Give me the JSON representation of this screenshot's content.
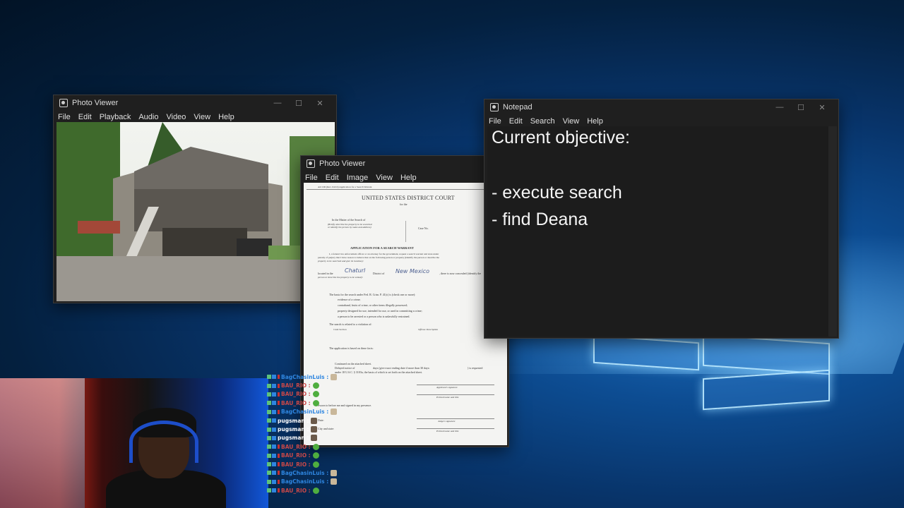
{
  "desktop": {
    "accent": "#0d4d93"
  },
  "photo_viewer_1": {
    "title": "Photo Viewer",
    "menu": [
      "File",
      "Edit",
      "Playback",
      "Audio",
      "Video",
      "View",
      "Help"
    ],
    "image_alt": "house-photo"
  },
  "photo_viewer_2": {
    "title": "Photo Viewer",
    "menu": [
      "File",
      "Edit",
      "Image",
      "View",
      "Help"
    ],
    "document": {
      "form_id": "AO 106 (Rev. 04/10) Application for a Search Warrant",
      "court": "UNITED STATES DISTRICT COURT",
      "for_the": "for the",
      "matter": "In the Matter of the Search of",
      "matter_sub1": "(Briefly describe the property to be searched",
      "matter_sub2": "or identify the person by name and address)",
      "case_no": "Case No.",
      "heading": "APPLICATION FOR A SEARCH WARRANT",
      "para1": "I, a federal law enforcement officer or an attorney for the government, request a search warrant and state under",
      "para2": "penalty of perjury that I have reason to believe that on the following person or property (identify the person or describe the",
      "para3": "property to be searched and give its location):",
      "located_in": "located in the",
      "handwritten_place": "Chaturl",
      "district_of": "District of",
      "handwritten_state": "New Mexico",
      "concealed": ", there is now concealed (identify the",
      "person_desc": "person or describe the property to be seized):",
      "basis": "The basis for the search under Fed. R. Crim. P. 41(c) is (check one or more):",
      "check1": "evidence of a crime;",
      "check2": "contraband, fruits of crime, or other items illegally possessed;",
      "check3": "property designed for use, intended for use, or used in committing a crime;",
      "check4": "a person to be arrested or a person who is unlawfully restrained.",
      "related": "The search is related to a violation of:",
      "code_section": "Code Section",
      "offense": "Offense Description",
      "based_on": "The application is based on these facts:",
      "continued": "Continued on the attached sheet.",
      "delayed": "Delayed notice of",
      "days_text": "days (give exact ending date if more than 30 days:",
      "requested": ") is requested",
      "under": "under 18 U.S.C. § 3103a, the basis of which is set forth on the attached sheet.",
      "applicant_sig": "Applicant's signature",
      "printed_name": "Printed name and title",
      "sworn": "Sworn to before me and signed in my presence.",
      "date_label": "Date:",
      "judge_sig": "Judge's signature",
      "city_state": "City and state:",
      "printed_name2": "Printed name and title"
    }
  },
  "notepad": {
    "title": "Notepad",
    "menu": [
      "File",
      "Edit",
      "Search",
      "View",
      "Help"
    ],
    "lines": [
      "Current objective:",
      "",
      "- execute search",
      "- find Deana"
    ]
  },
  "chat": {
    "messages": [
      {
        "user": "BagChasinLuis :",
        "color": "#2f86e0",
        "emote": "dog"
      },
      {
        "user": "BAU_RIO :",
        "color": "#c94848",
        "emote": "green"
      },
      {
        "user": "BAU_RIO :",
        "color": "#c94848",
        "emote": "green"
      },
      {
        "user": "BAU_RIO :",
        "color": "#c94848",
        "emote": "green"
      },
      {
        "user": "BagChasinLuis :",
        "color": "#2f86e0",
        "emote": "dog"
      },
      {
        "user": "pugsman :",
        "color": "#ffffff",
        "emote": "brown"
      },
      {
        "user": "pugsman :",
        "color": "#ffffff",
        "emote": "brown"
      },
      {
        "user": "pugsman :",
        "color": "#ffffff",
        "emote": "brown"
      },
      {
        "user": "BAU_RIO :",
        "color": "#c94848",
        "emote": "green"
      },
      {
        "user": "BAU_RIO :",
        "color": "#c94848",
        "emote": "green"
      },
      {
        "user": "BAU_RIO :",
        "color": "#c94848",
        "emote": "green"
      },
      {
        "user": "BagChasinLuis :",
        "color": "#2f86e0",
        "emote": "dog"
      },
      {
        "user": "BagChasinLuis :",
        "color": "#2f86e0",
        "emote": "dog"
      },
      {
        "user": "BAU_RIO :",
        "color": "#c94848",
        "emote": "green"
      }
    ]
  }
}
